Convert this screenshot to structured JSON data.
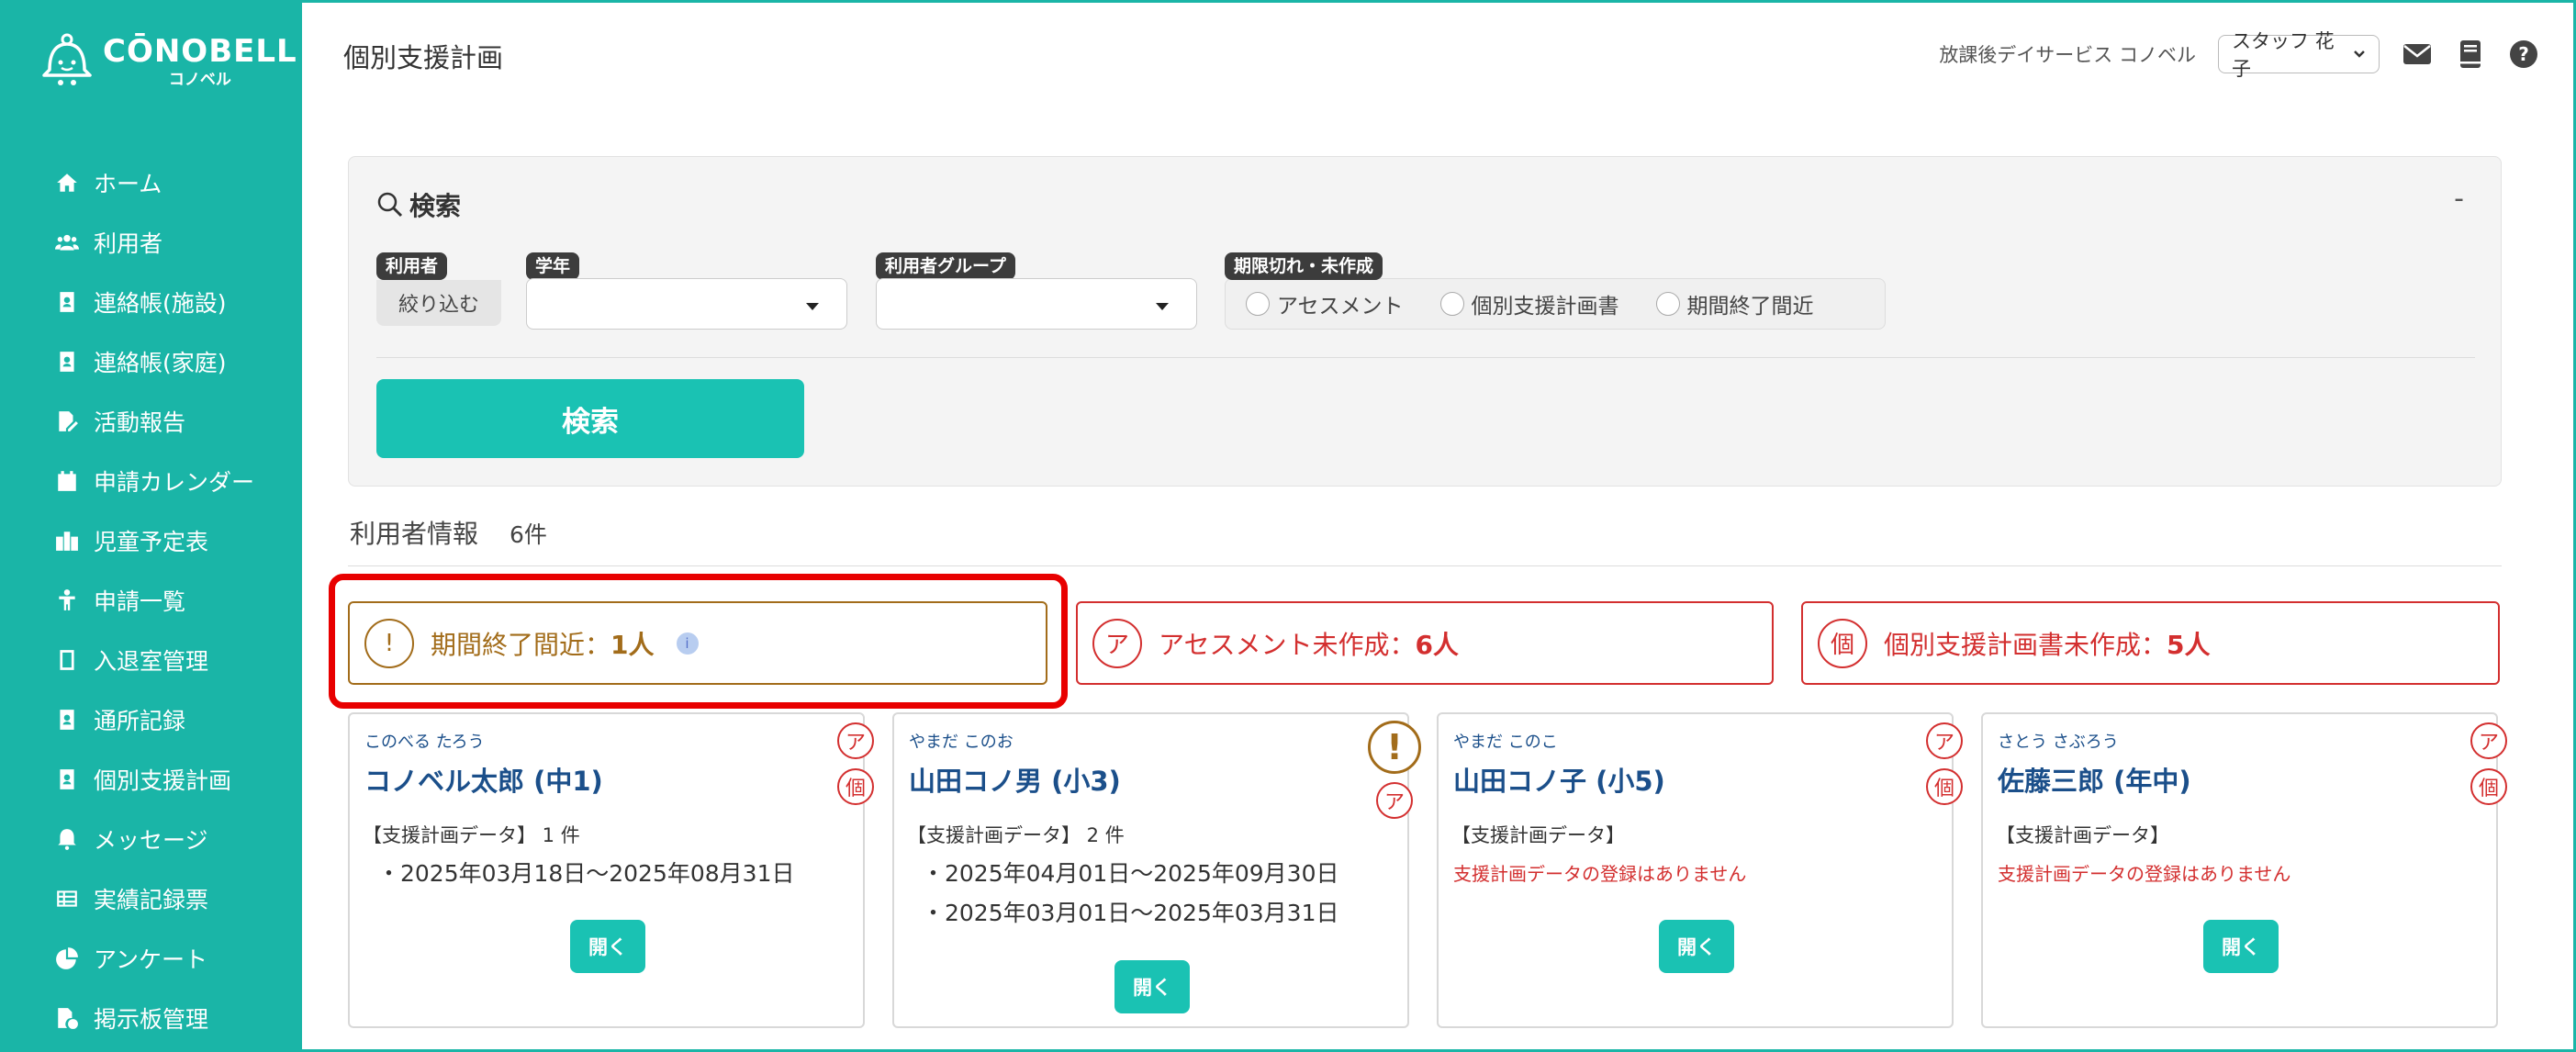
{
  "brand": {
    "name": "CŌNOBELL",
    "sub": "コノベル"
  },
  "sidebar": {
    "items": [
      {
        "label": "ホーム",
        "icon": "home-icon"
      },
      {
        "label": "利用者",
        "icon": "users-icon"
      },
      {
        "label": "連絡帳(施設)",
        "icon": "contact-book-icon"
      },
      {
        "label": "連絡帳(家庭)",
        "icon": "contact-book-icon"
      },
      {
        "label": "活動報告",
        "icon": "report-edit-icon"
      },
      {
        "label": "申請カレンダー",
        "icon": "calendar-icon"
      },
      {
        "label": "児童予定表",
        "icon": "building-icon"
      },
      {
        "label": "申請一覧",
        "icon": "child-icon"
      },
      {
        "label": "入退室管理",
        "icon": "tablet-icon"
      },
      {
        "label": "通所記録",
        "icon": "record-icon"
      },
      {
        "label": "個別支援計画",
        "icon": "plan-icon"
      },
      {
        "label": "メッセージ",
        "icon": "bell-icon"
      },
      {
        "label": "実績記録票",
        "icon": "table-icon"
      },
      {
        "label": "アンケート",
        "icon": "pie-chart-icon"
      },
      {
        "label": "掲示板管理",
        "icon": "board-icon"
      }
    ]
  },
  "header": {
    "title": "個別支援計画",
    "facility": "放課後デイサービス コノベル",
    "staff": "スタッフ 花子"
  },
  "search": {
    "title": "検索",
    "collapse": "-",
    "user_tag": "利用者",
    "narrow_label": "絞り込む",
    "grade_tag": "学年",
    "group_tag": "利用者グループ",
    "expiry_tag": "期限切れ・未作成",
    "options": [
      "アセスメント",
      "個別支援計画書",
      "期間終了間近"
    ],
    "button": "検索"
  },
  "users_info": {
    "title": "利用者情報",
    "count": "6件"
  },
  "alerts": {
    "near_end": {
      "icon": "!",
      "label": "期間終了間近：",
      "value": "1人",
      "info": "i"
    },
    "assessment": {
      "icon": "ア",
      "label": "アセスメント未作成：",
      "value": "6人"
    },
    "plan": {
      "icon": "個",
      "label": "個別支援計画書未作成：",
      "value": "5人"
    }
  },
  "cards": [
    {
      "kana": "このべる たろう",
      "name": "コノベル太郎 (中1)",
      "plan_label": "【支援計画データ】 1 件",
      "periods": [
        "・2025年03月18日～2025年08月31日"
      ],
      "no_data": "",
      "badges": [
        "ア",
        "個"
      ],
      "button": "開く"
    },
    {
      "kana": "やまだ このお",
      "name": "山田コノ男 (小3)",
      "plan_label": "【支援計画データ】 2 件",
      "periods": [
        "・2025年04月01日～2025年09月30日",
        "・2025年03月01日～2025年03月31日"
      ],
      "no_data": "",
      "badges": [
        "!",
        "ア"
      ],
      "button": "開く"
    },
    {
      "kana": "やまだ このこ",
      "name": "山田コノ子 (小5)",
      "plan_label": "【支援計画データ】",
      "periods": [],
      "no_data": "支援計画データの登録はありません",
      "badges": [
        "ア",
        "個"
      ],
      "button": "開く"
    },
    {
      "kana": "さとう さぶろう",
      "name": "佐藤三郎 (年中)",
      "plan_label": "【支援計画データ】",
      "periods": [],
      "no_data": "支援計画データの登録はありません",
      "badges": [
        "ア",
        "個"
      ],
      "button": "開く"
    }
  ],
  "colors": {
    "brand": "#1ab5a7",
    "button": "#1ac2b3",
    "warn": "#a26c1a",
    "danger": "#d32f2f",
    "highlight": "#e80000",
    "name": "#1b4f8a"
  }
}
